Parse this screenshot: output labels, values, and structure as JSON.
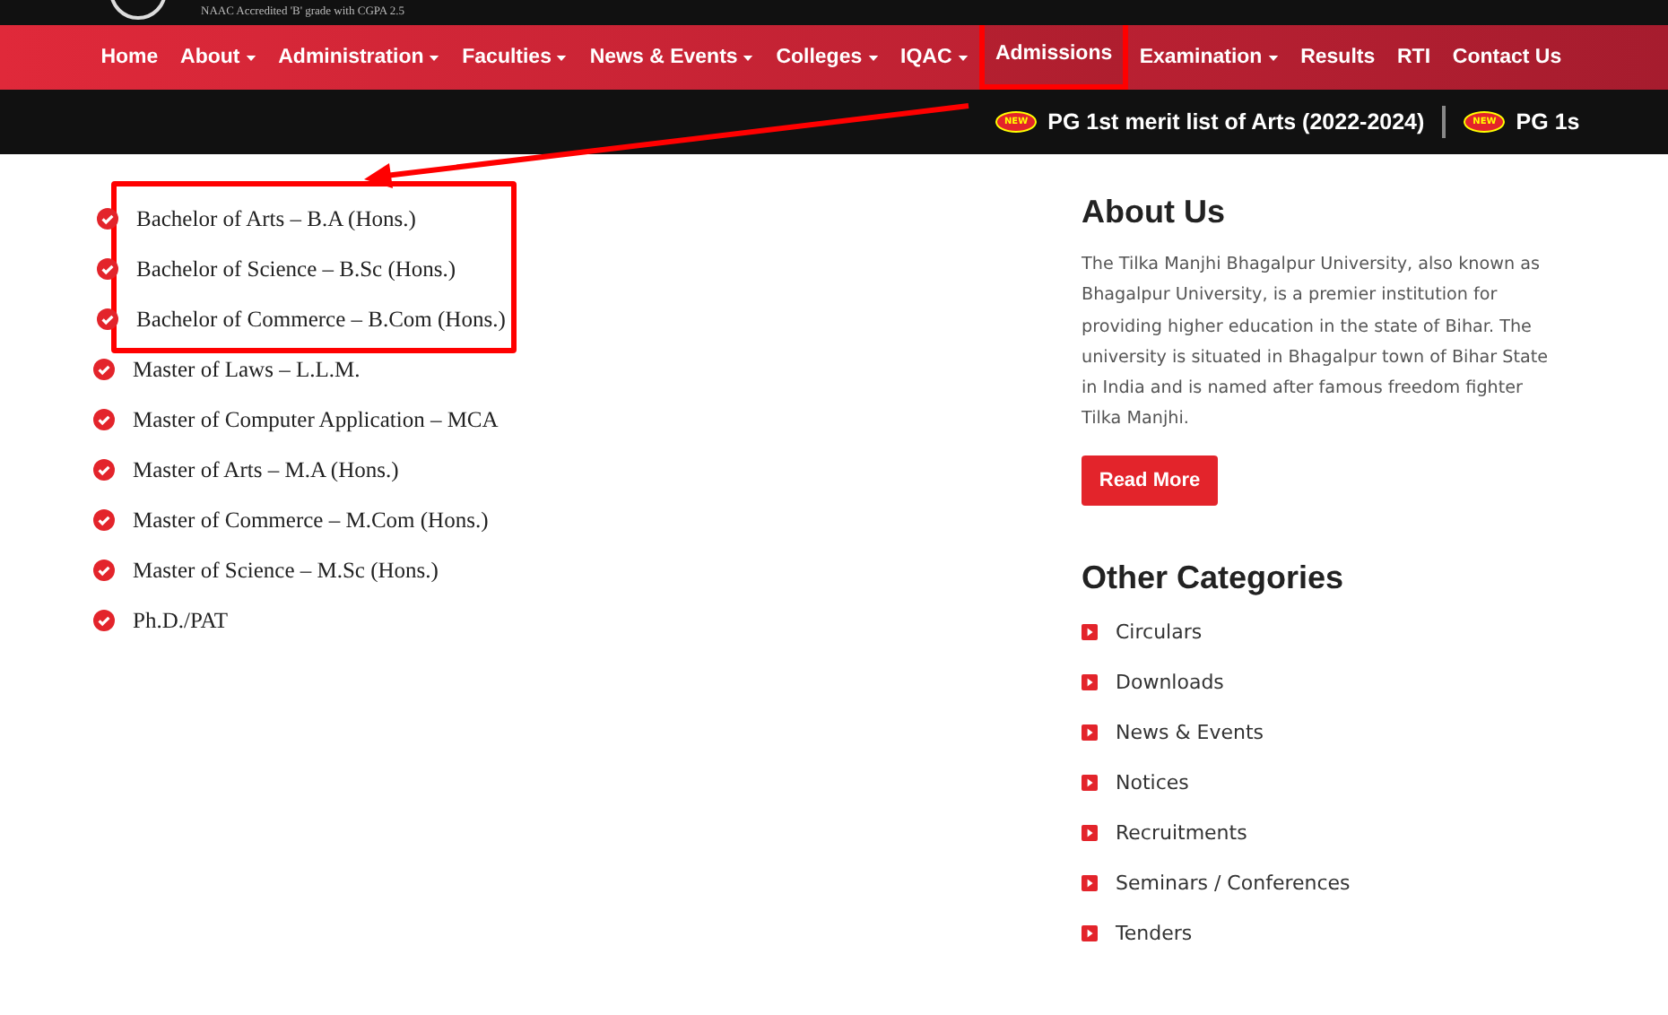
{
  "header": {
    "tagline": "NAAC Accredited 'B' grade with CGPA 2.5"
  },
  "nav": [
    {
      "label": "Home",
      "dropdown": false,
      "highlighted": false
    },
    {
      "label": "About",
      "dropdown": true,
      "highlighted": false
    },
    {
      "label": "Administration",
      "dropdown": true,
      "highlighted": false
    },
    {
      "label": "Faculties",
      "dropdown": true,
      "highlighted": false
    },
    {
      "label": "News & Events",
      "dropdown": true,
      "highlighted": false
    },
    {
      "label": "Colleges",
      "dropdown": true,
      "highlighted": false
    },
    {
      "label": "IQAC",
      "dropdown": true,
      "highlighted": false
    },
    {
      "label": "Admissions",
      "dropdown": false,
      "highlighted": true
    },
    {
      "label": "Examination",
      "dropdown": true,
      "highlighted": false
    },
    {
      "label": "Results",
      "dropdown": false,
      "highlighted": false
    },
    {
      "label": "RTI",
      "dropdown": false,
      "highlighted": false
    },
    {
      "label": "Contact Us",
      "dropdown": false,
      "highlighted": false
    }
  ],
  "ticker": [
    {
      "badge": "NEW",
      "text": "PG 1st merit list of Arts (2022-2024)"
    },
    {
      "badge": "NEW",
      "text": "PG 1s"
    }
  ],
  "programs": [
    {
      "label": "Bachelor of Arts – B.A (Hons.)",
      "highlighted": true
    },
    {
      "label": "Bachelor of Science – B.Sc (Hons.)",
      "highlighted": true
    },
    {
      "label": "Bachelor of Commerce – B.Com (Hons.)",
      "highlighted": true
    },
    {
      "label": "Master of Laws – L.L.M.",
      "highlighted": false
    },
    {
      "label": "Master of Computer Application – MCA",
      "highlighted": false
    },
    {
      "label": "Master of Arts – M.A (Hons.)",
      "highlighted": false
    },
    {
      "label": "Master of Commerce – M.Com (Hons.)",
      "highlighted": false
    },
    {
      "label": "Master of Science – M.Sc (Hons.)",
      "highlighted": false
    },
    {
      "label": "Ph.D./PAT",
      "highlighted": false
    }
  ],
  "about": {
    "title": "About Us",
    "text": "The Tilka Manjhi Bhagalpur University, also known as Bhagalpur University, is a premier institution for providing higher education in the state of Bihar. The university is situated in Bhagalpur town of Bihar State in India and is named after famous freedom fighter Tilka Manjhi.",
    "button": "Read More"
  },
  "categories": {
    "title": "Other Categories",
    "items": [
      "Circulars",
      "Downloads",
      "News & Events",
      "Notices",
      "Recruitments",
      "Seminars / Conferences",
      "Tenders"
    ]
  }
}
